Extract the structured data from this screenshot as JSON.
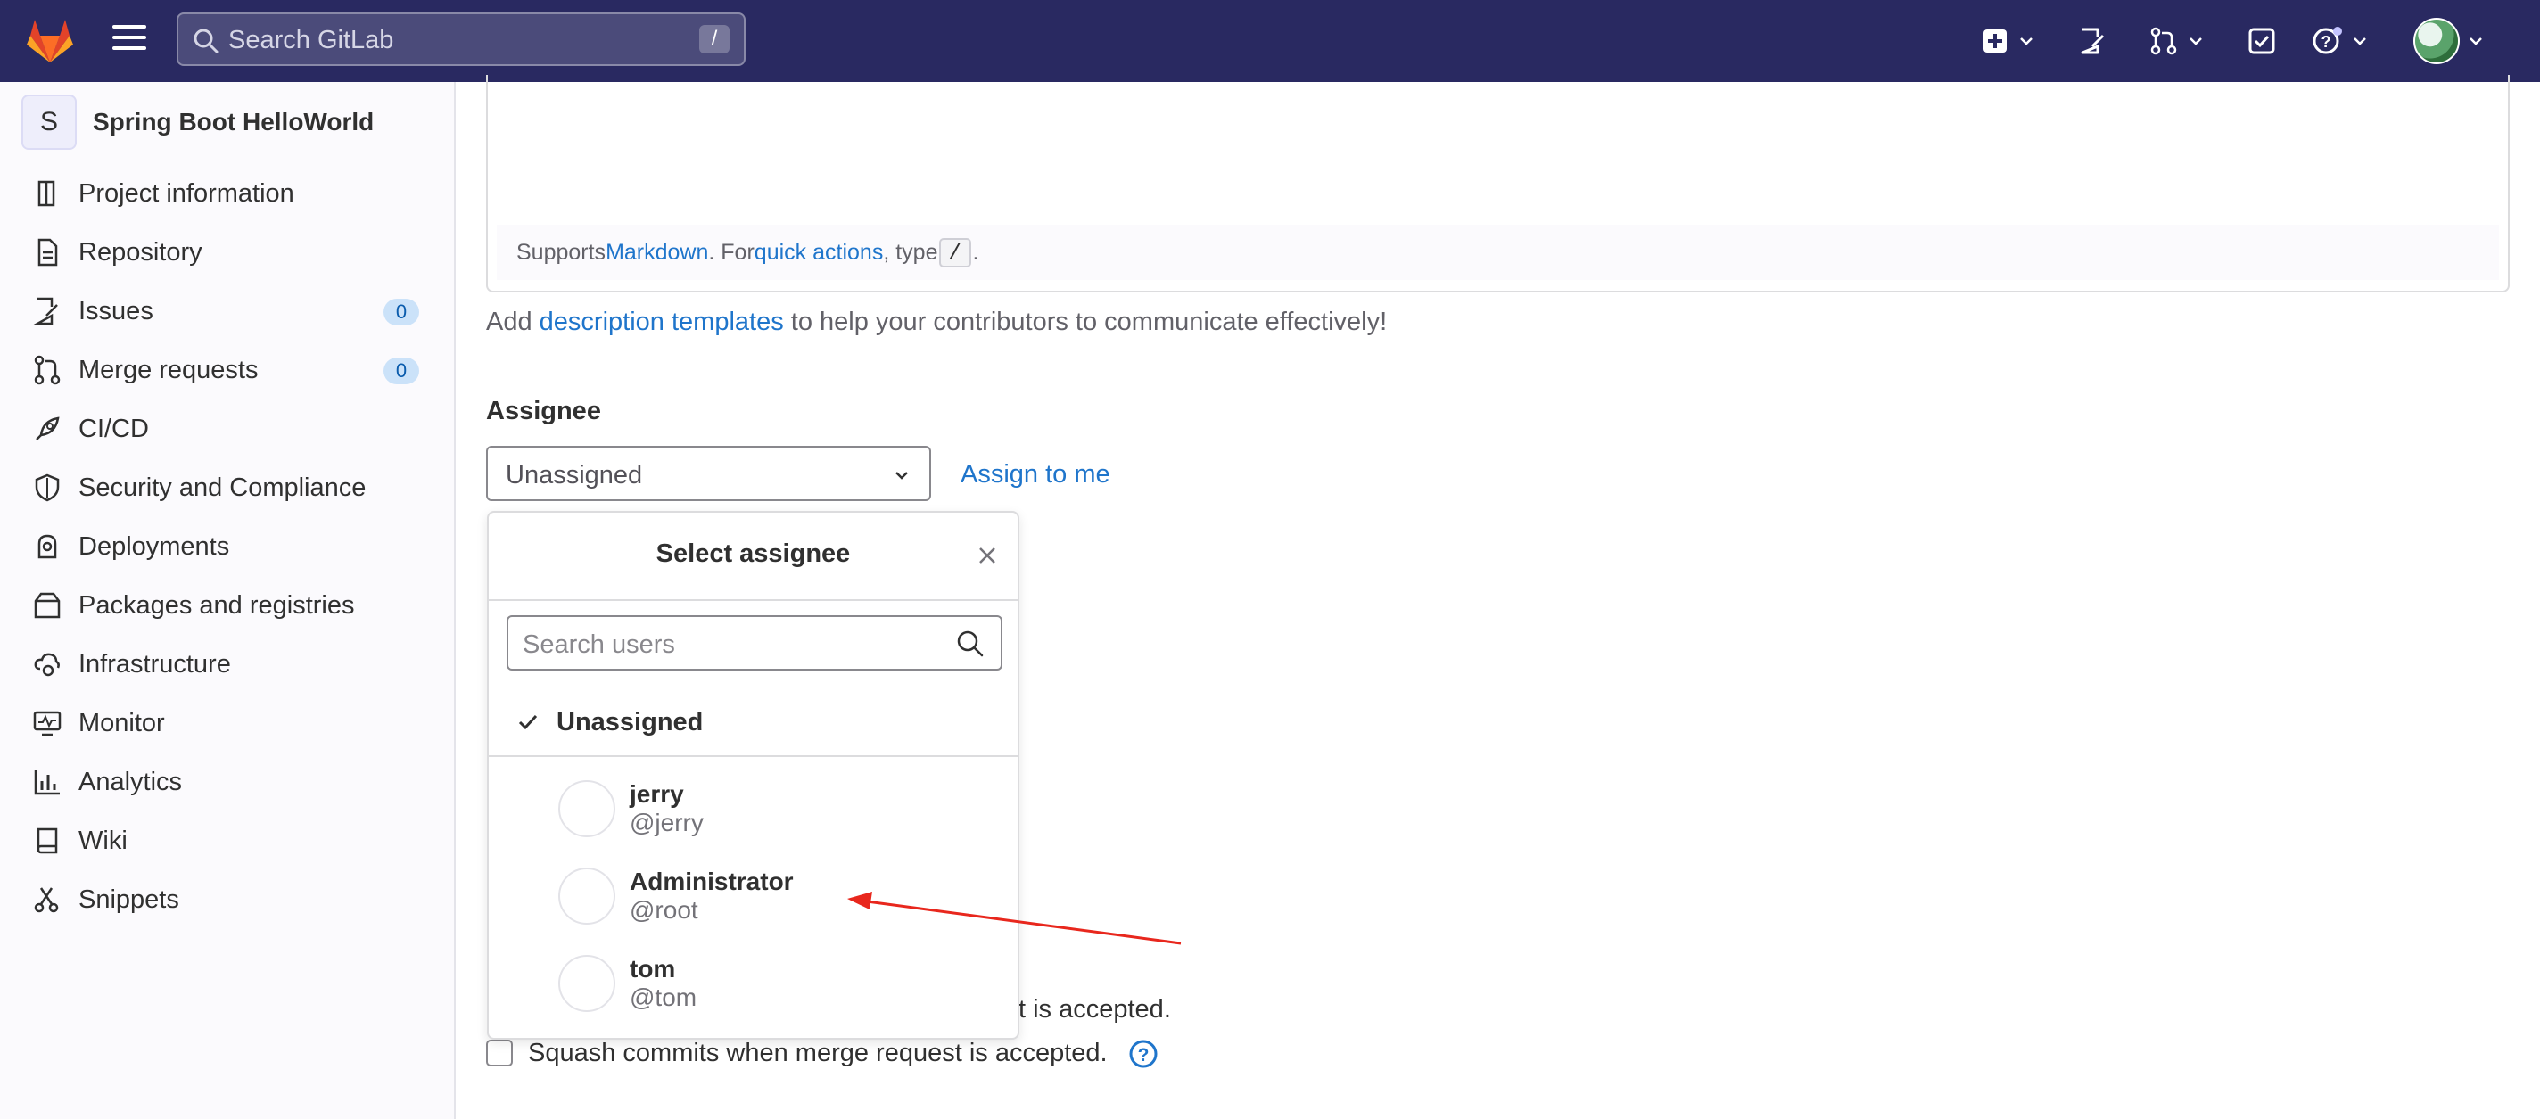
{
  "topbar": {
    "search_placeholder": "Search GitLab",
    "search_shortcut": "/",
    "icons": [
      "gitlab-logo-icon",
      "menu-icon",
      "search-icon",
      "plus-square-icon",
      "issues-icon",
      "merge-request-icon",
      "todo-icon",
      "help-icon",
      "user-avatar-icon"
    ]
  },
  "sidebar": {
    "project_avatar_letter": "S",
    "project_name": "Spring Boot HelloWorld",
    "items": [
      {
        "label": "Project information",
        "icon": "project-icon"
      },
      {
        "label": "Repository",
        "icon": "document-icon"
      },
      {
        "label": "Issues",
        "icon": "issues-icon",
        "badge": "0"
      },
      {
        "label": "Merge requests",
        "icon": "merge-request-icon",
        "badge": "0"
      },
      {
        "label": "CI/CD",
        "icon": "rocket-icon"
      },
      {
        "label": "Security and Compliance",
        "icon": "shield-icon"
      },
      {
        "label": "Deployments",
        "icon": "deployments-icon"
      },
      {
        "label": "Packages and registries",
        "icon": "package-icon"
      },
      {
        "label": "Infrastructure",
        "icon": "cloud-gear-icon"
      },
      {
        "label": "Monitor",
        "icon": "monitor-icon"
      },
      {
        "label": "Analytics",
        "icon": "chart-icon"
      },
      {
        "label": "Wiki",
        "icon": "book-icon"
      },
      {
        "label": "Snippets",
        "icon": "scissors-icon"
      }
    ]
  },
  "editor": {
    "supports": "Supports ",
    "markdown_link": "Markdown",
    "mid": ". For ",
    "quick_actions_link": "quick actions",
    "type_text": ", type ",
    "slash": "/",
    "end": "."
  },
  "templates": {
    "prefix": "Add ",
    "link": "description templates",
    "suffix": " to help your contributors to communicate effectively!"
  },
  "assignee": {
    "label": "Assignee",
    "value": "Unassigned",
    "assign_to_me": "Assign to me"
  },
  "popup": {
    "title": "Select assignee",
    "search_placeholder": "Search users",
    "unassigned_label": "Unassigned",
    "users": [
      {
        "name": "jerry",
        "handle": "@jerry"
      },
      {
        "name": "Administrator",
        "handle": "@root"
      },
      {
        "name": "tom",
        "handle": "@tom"
      }
    ]
  },
  "options": {
    "partial_text": "t is accepted.",
    "squash_label": "Squash commits when merge request is accepted."
  },
  "colors": {
    "topbar": "#292961",
    "link": "#1f75cb",
    "annotation_arrow": "#e8271d"
  }
}
